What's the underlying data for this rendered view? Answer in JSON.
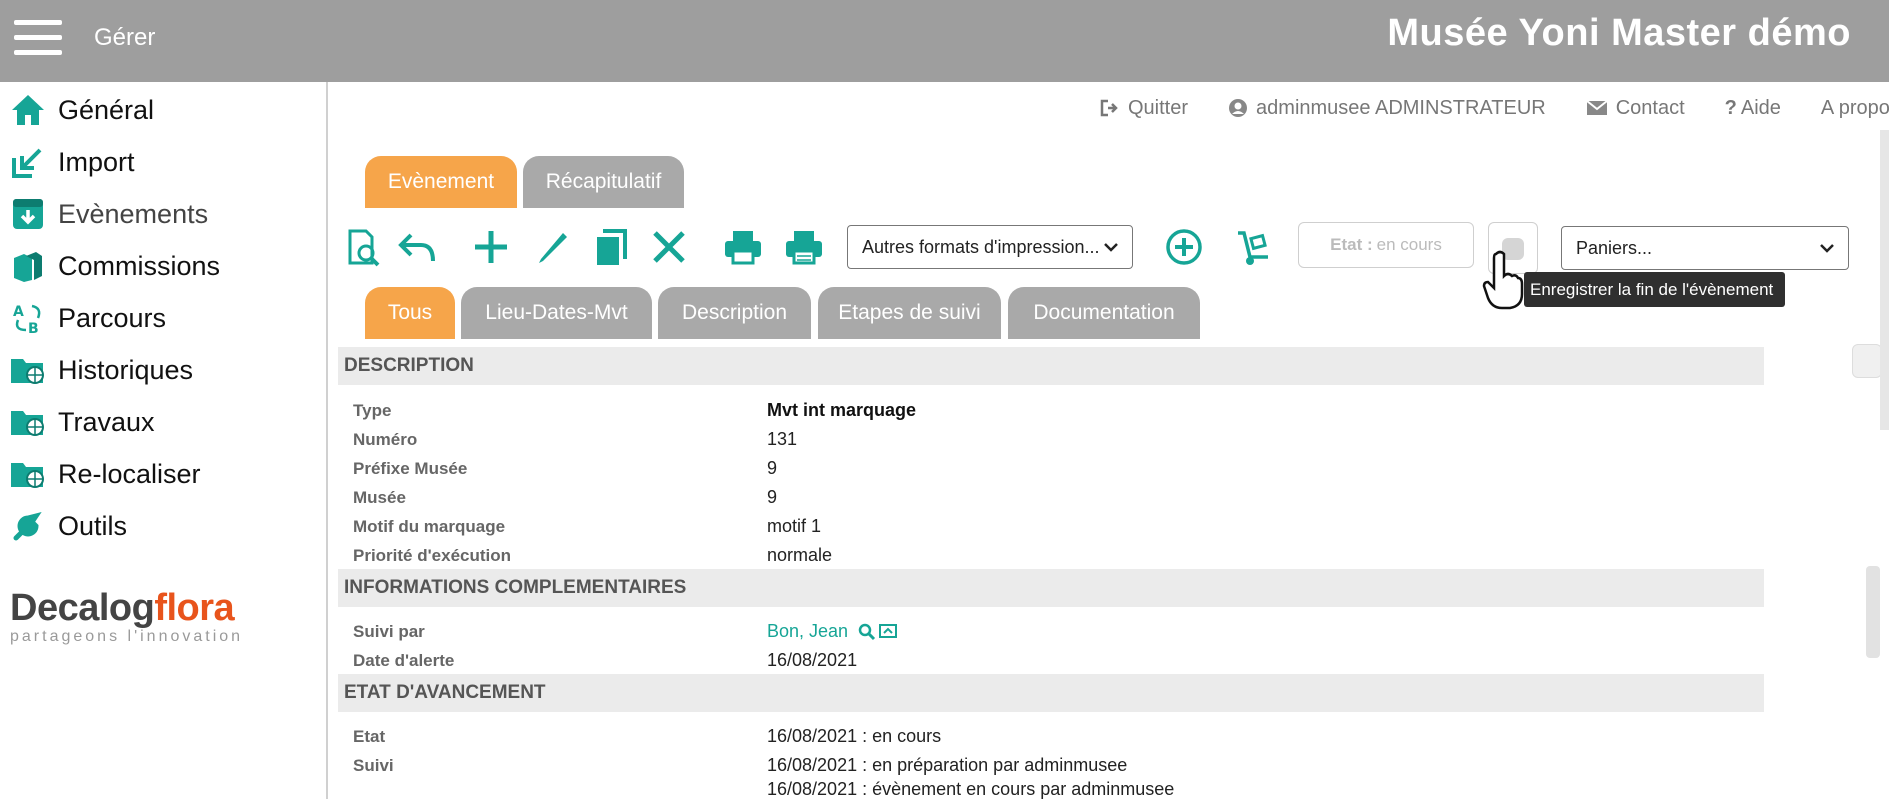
{
  "header": {
    "menu_label": "Gérer",
    "app_title": "Musée Yoni Master démo"
  },
  "sidebar": {
    "items": [
      {
        "label": "Général",
        "icon": "home-icon"
      },
      {
        "label": "Import",
        "icon": "import-icon"
      },
      {
        "label": "Evènements",
        "icon": "events-icon"
      },
      {
        "label": "Commissions",
        "icon": "commissions-icon"
      },
      {
        "label": "Parcours",
        "icon": "parcours-icon"
      },
      {
        "label": "Historiques",
        "icon": "historiques-icon"
      },
      {
        "label": "Travaux",
        "icon": "travaux-icon"
      },
      {
        "label": "Re-localiser",
        "icon": "relocaliser-icon"
      },
      {
        "label": "Outils",
        "icon": "wrench-icon"
      }
    ],
    "brand": {
      "part1": "Decalog",
      "part2": "flora",
      "tagline": "partageons l'innovation"
    }
  },
  "toplinks": [
    {
      "label": "Quitter",
      "icon": "logout-icon"
    },
    {
      "label": "adminmusee ADMINSTRATEUR",
      "icon": "user-icon"
    },
    {
      "label": "Contact",
      "icon": "mail-icon"
    },
    {
      "label": "Aide",
      "icon": "question-icon"
    },
    {
      "label": "A propos",
      "icon": ""
    }
  ],
  "main_tabs": [
    {
      "label": "Evènement",
      "active": true
    },
    {
      "label": "Récapitulatif",
      "active": false
    }
  ],
  "toolbar": {
    "print_formats_label": "Autres formats d'impression...",
    "state_label": "Etat :",
    "state_value": "en cours",
    "baskets_label": "Paniers...",
    "tooltip": "Enregistrer la fin de l'évènement"
  },
  "sub_tabs": [
    {
      "label": "Tous",
      "active": true
    },
    {
      "label": "Lieu-Dates-Mvt",
      "active": false
    },
    {
      "label": "Description",
      "active": false
    },
    {
      "label": "Etapes de suivi",
      "active": false
    },
    {
      "label": "Documentation",
      "active": false
    }
  ],
  "sections": {
    "description": {
      "title": "DESCRIPTION",
      "rows": [
        {
          "key": "Type",
          "value": "Mvt int marquage"
        },
        {
          "key": "Numéro",
          "value": "131"
        },
        {
          "key": "Préfixe Musée",
          "value": "9"
        },
        {
          "key": "Musée",
          "value": "9"
        },
        {
          "key": "Motif du marquage",
          "value": "motif 1"
        },
        {
          "key": "Priorité d'exécution",
          "value": "normale"
        }
      ]
    },
    "infos": {
      "title": "INFORMATIONS COMPLEMENTAIRES",
      "rows": [
        {
          "key": "Suivi par",
          "value": "Bon, Jean"
        },
        {
          "key": "Date d'alerte",
          "value": "16/08/2021"
        }
      ]
    },
    "avancement": {
      "title": "ETAT D'AVANCEMENT",
      "rows": [
        {
          "key": "Etat",
          "value": "16/08/2021 : en cours"
        },
        {
          "key": "Suivi",
          "value": "16/08/2021 : en préparation par adminmusee"
        },
        {
          "key": "",
          "value": "16/08/2021 : évènement en cours par adminmusee"
        }
      ]
    }
  },
  "colors": {
    "accent": "#16a596",
    "tab_active": "#f6a54a",
    "tab_inactive": "#a9a9a9",
    "header": "#9e9e9e"
  }
}
